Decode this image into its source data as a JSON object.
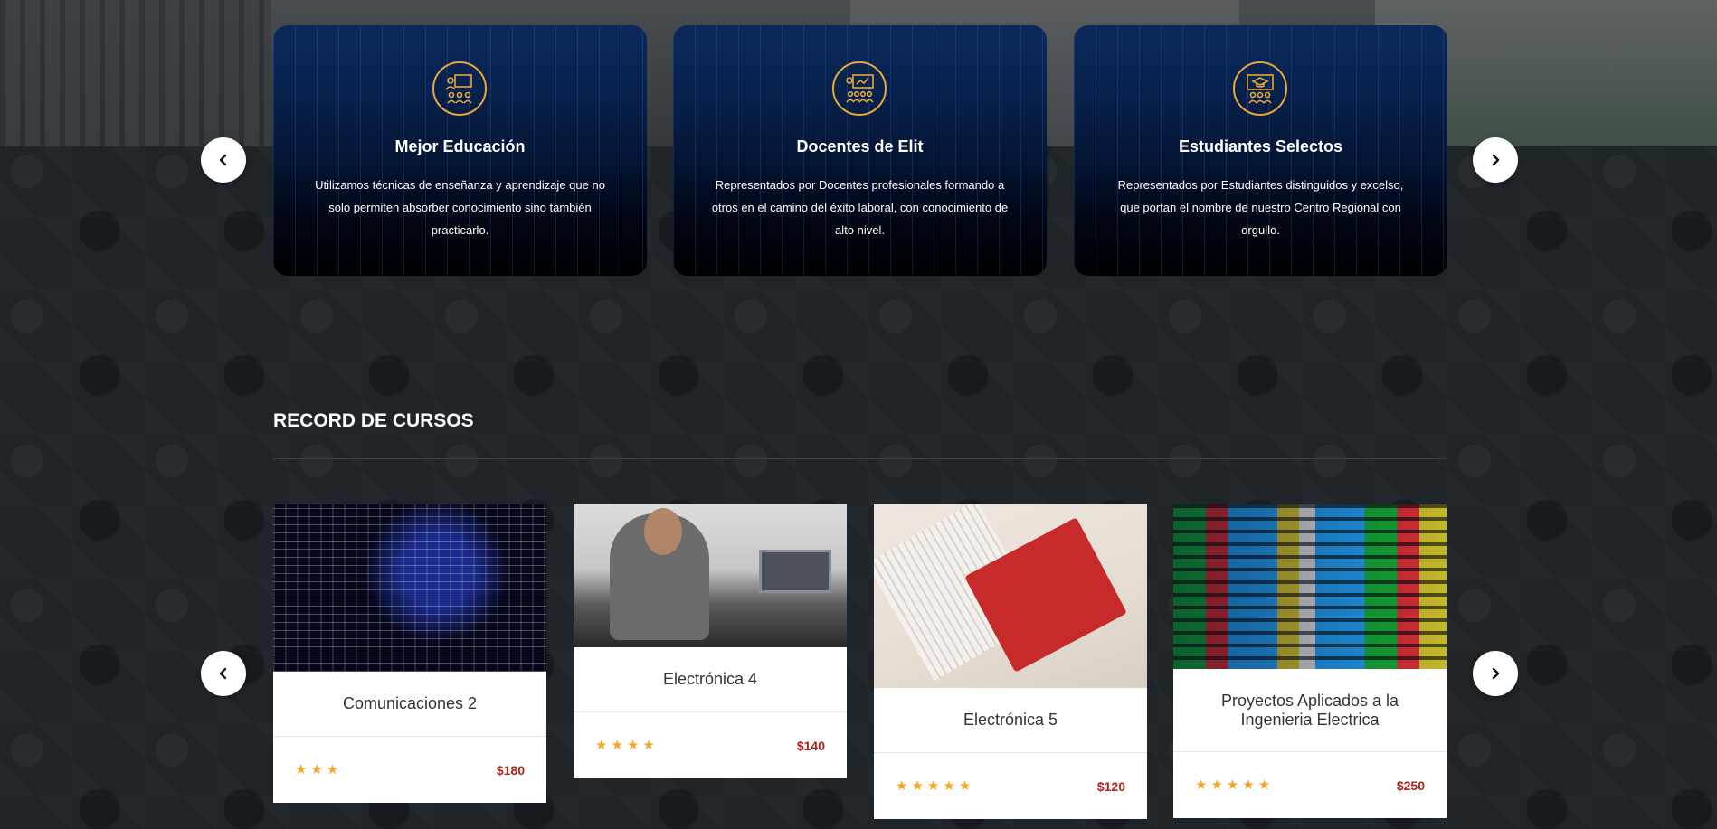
{
  "features": [
    {
      "icon": "education-icon",
      "title": "Mejor Educación",
      "description": "Utilizamos técnicas de enseñanza y aprendizaje que no solo permiten absorber conocimiento sino también practicarlo."
    },
    {
      "icon": "teacher-icon",
      "title": "Docentes de Elit",
      "description": "Representados por Docentes profesionales formando a otros en el camino del éxito laboral, con conocimiento de alto nivel."
    },
    {
      "icon": "students-icon",
      "title": "Estudiantes Selectos",
      "description": "Representados por Estudiantes distinguidos y excelso, que portan el nombre de nuestro Centro Regional con orgullo."
    }
  ],
  "courses_section": {
    "title": "RECORD DE CURSOS"
  },
  "courses": [
    {
      "name": "Comunicaciones 2",
      "rating": 3,
      "price": "$180"
    },
    {
      "name": "Electrónica 4",
      "rating": 4,
      "price": "$140"
    },
    {
      "name": "Electrónica 5",
      "rating": 5,
      "price": "$120"
    },
    {
      "name": "Proyectos Aplicados a la Ingenieria Electrica",
      "rating": 5,
      "price": "$250"
    }
  ],
  "colors": {
    "accent_gold": "#e9a63a",
    "star": "#f5a623",
    "price": "#b0221c"
  }
}
